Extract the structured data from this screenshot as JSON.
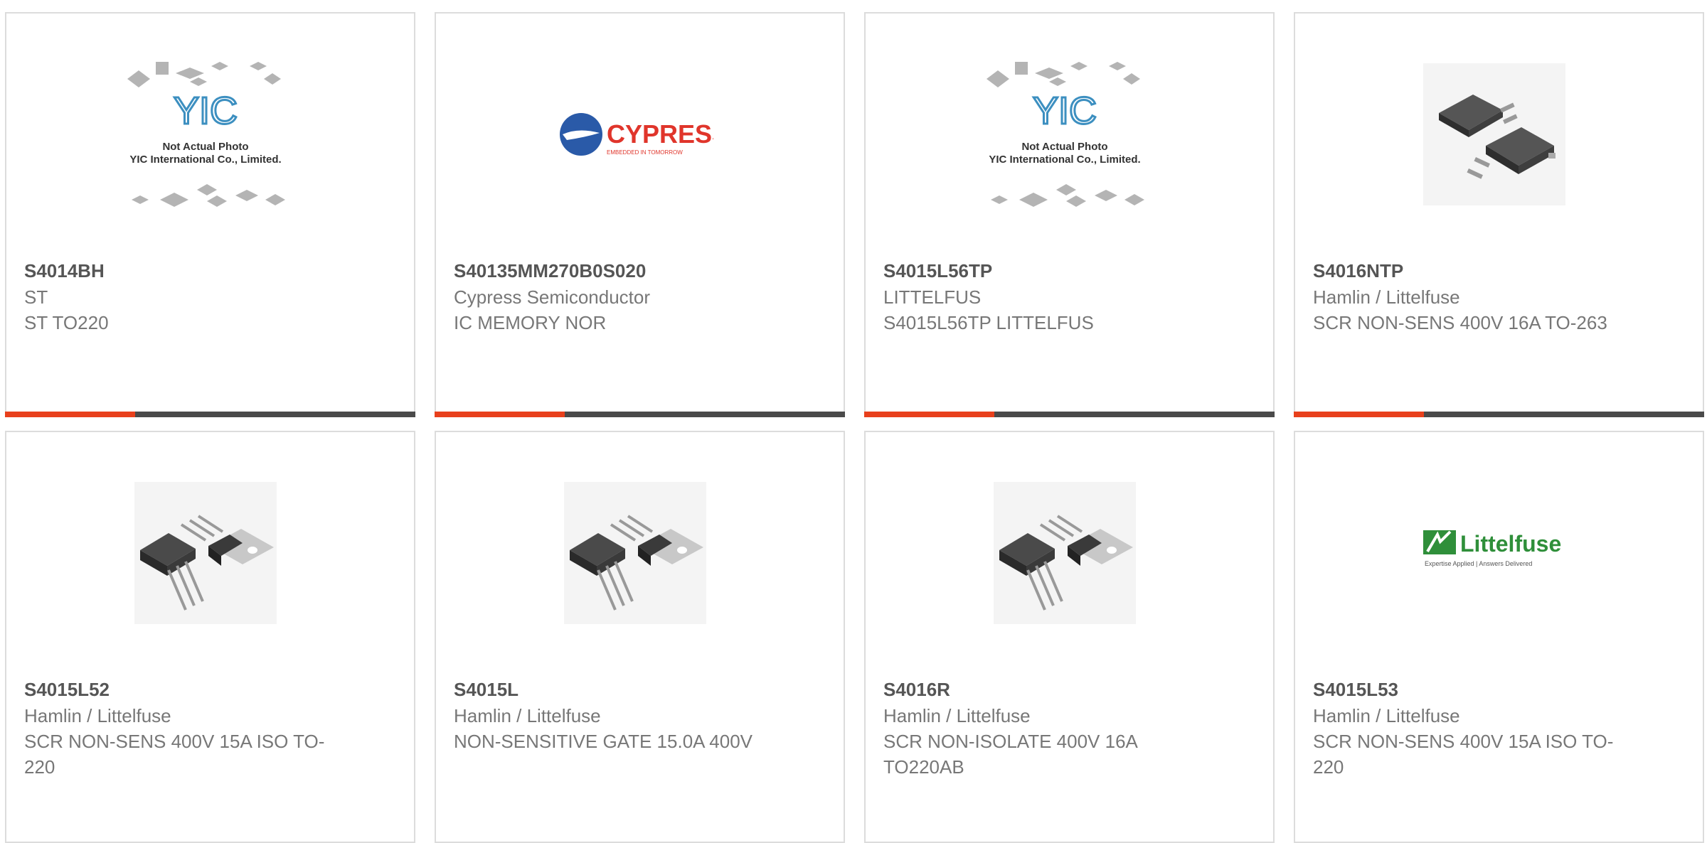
{
  "products": [
    {
      "part_number": "S4014BH",
      "manufacturer": "ST",
      "description": "ST TO220",
      "image": "yic-not-actual-photo",
      "image_text_1": "Not Actual Photo",
      "image_text_2": "YIC International Co., Limited."
    },
    {
      "part_number": "S40135MM270B0S020",
      "manufacturer": "Cypress Semiconductor",
      "description": "IC MEMORY NOR",
      "image": "cypress-logo",
      "logo_text": "CYPRESS",
      "logo_tagline": "EMBEDDED IN TOMORROW"
    },
    {
      "part_number": "S4015L56TP",
      "manufacturer": "LITTELFUS",
      "description": "S4015L56TP LITTELFUS",
      "image": "yic-not-actual-photo",
      "image_text_1": "Not Actual Photo",
      "image_text_2": "YIC International Co., Limited."
    },
    {
      "part_number": "S4016NTP",
      "manufacturer": "Hamlin / Littelfuse",
      "description": "SCR NON-SENS 400V 16A TO-263",
      "image": "to263-package"
    },
    {
      "part_number": "S4015L52",
      "manufacturer": "Hamlin / Littelfuse",
      "description": "SCR NON-SENS 400V 15A ISO TO-220",
      "image": "to220-package"
    },
    {
      "part_number": "S4015L",
      "manufacturer": "Hamlin / Littelfuse",
      "description": "NON-SENSITIVE GATE 15.0A 400V",
      "image": "to220-package"
    },
    {
      "part_number": "S4016R",
      "manufacturer": "Hamlin / Littelfuse",
      "description": "SCR NON-ISOLATE 400V 16A TO220AB",
      "image": "to220-package"
    },
    {
      "part_number": "S4015L53",
      "manufacturer": "Hamlin / Littelfuse",
      "description": "SCR NON-SENS 400V 15A ISO TO-220",
      "image": "littelfuse-logo",
      "logo_text": "Littelfuse",
      "logo_tagline": "Expertise Applied | Answers Delivered"
    }
  ],
  "colors": {
    "accent": "#e8401c",
    "bar_dark": "#4a4a4a",
    "border": "#dcdcdc",
    "part_number": "#555555",
    "text": "#777777"
  }
}
